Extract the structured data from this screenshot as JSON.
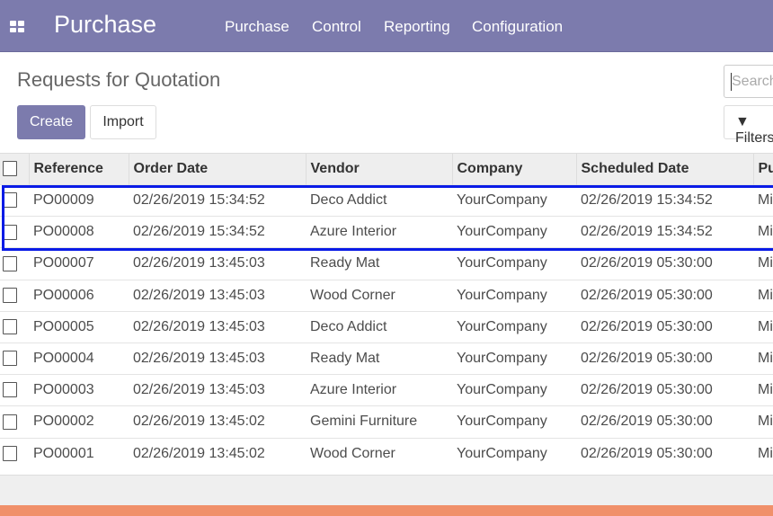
{
  "nav": {
    "brand": "Purchase",
    "menu": [
      "Purchase",
      "Control",
      "Reporting",
      "Configuration"
    ]
  },
  "control": {
    "title": "Requests for Quotation",
    "create": "Create",
    "import": "Import",
    "search_placeholder": "Search",
    "filters": "Filters"
  },
  "table": {
    "headers": [
      "Reference",
      "Order Date",
      "Vendor",
      "Company",
      "Scheduled Date",
      "Pu"
    ],
    "rows": [
      [
        "PO00009",
        "02/26/2019 15:34:52",
        "Deco Addict",
        "YourCompany",
        "02/26/2019 15:34:52",
        "Mi"
      ],
      [
        "PO00008",
        "02/26/2019 15:34:52",
        "Azure Interior",
        "YourCompany",
        "02/26/2019 15:34:52",
        "Mi"
      ],
      [
        "PO00007",
        "02/26/2019 13:45:03",
        "Ready Mat",
        "YourCompany",
        "02/26/2019 05:30:00",
        "Mi"
      ],
      [
        "PO00006",
        "02/26/2019 13:45:03",
        "Wood Corner",
        "YourCompany",
        "02/26/2019 05:30:00",
        "Mi"
      ],
      [
        "PO00005",
        "02/26/2019 13:45:03",
        "Deco Addict",
        "YourCompany",
        "02/26/2019 05:30:00",
        "Mi"
      ],
      [
        "PO00004",
        "02/26/2019 13:45:03",
        "Ready Mat",
        "YourCompany",
        "02/26/2019 05:30:00",
        "Mi"
      ],
      [
        "PO00003",
        "02/26/2019 13:45:03",
        "Azure Interior",
        "YourCompany",
        "02/26/2019 05:30:00",
        "Mi"
      ],
      [
        "PO00002",
        "02/26/2019 13:45:02",
        "Gemini Furniture",
        "YourCompany",
        "02/26/2019 05:30:00",
        "Mi"
      ],
      [
        "PO00001",
        "02/26/2019 13:45:02",
        "Wood Corner",
        "YourCompany",
        "02/26/2019 05:30:00",
        "Mi"
      ]
    ]
  },
  "colors": {
    "brand": "#7c7bad",
    "highlight": "#0a1be6",
    "footer_bar": "#f0906a"
  }
}
